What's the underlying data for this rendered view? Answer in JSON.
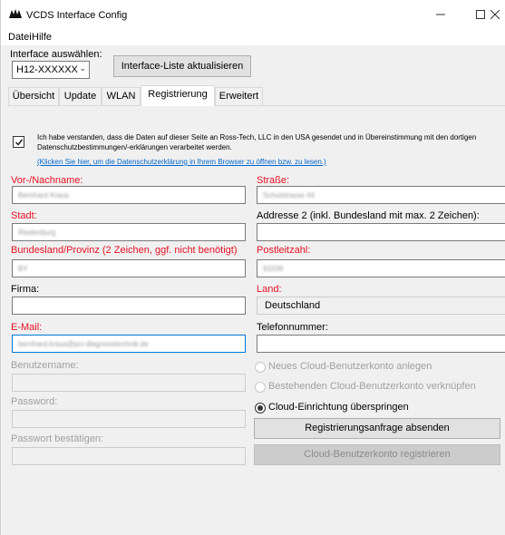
{
  "window": {
    "title": "VCDS Interface Config",
    "controls": {
      "minimize": "—",
      "maximize": "☐",
      "close": "×"
    }
  },
  "menu": {
    "items": [
      "Datei",
      "Hilfe"
    ]
  },
  "interface": {
    "label": "Interface auswählen:",
    "selected": "H12-XXXXXX",
    "refresh_button": "Interface-Liste aktualisieren"
  },
  "tabs": [
    {
      "label": "Übersicht",
      "active": false
    },
    {
      "label": "Update",
      "active": false
    },
    {
      "label": "WLAN",
      "active": false
    },
    {
      "label": "Registrierung",
      "active": true
    },
    {
      "label": "Erweitert",
      "active": false
    }
  ],
  "consent": {
    "checked": true,
    "text": "Ich habe verstanden, dass die Daten auf dieser Seite an Ross-Tech, LLC in den USA gesendet und in Übereinstimmung mit den dortigen Datenschutzbestimmungen/-erklärungen verarbeitet werden.",
    "link": "(Klicken Sie hier, um die Datenschutzerklärung in Ihrem Browser zu öffnen bzw. zu lesen.)"
  },
  "form": {
    "name": {
      "label": "Vor-/Nachname:",
      "value": "Bernhard Kraus"
    },
    "street": {
      "label": "Straße:",
      "value": "Schulstrasse 44"
    },
    "city": {
      "label": "Stadt:",
      "value": "Riedenburg"
    },
    "address2": {
      "label": "Addresse 2 (inkl. Bundesland mit max. 2 Zeichen):",
      "value": ""
    },
    "state": {
      "label": "Bundesland/Provinz (2 Zeichen, ggf. nicht benötigt)",
      "value": "BY"
    },
    "zip": {
      "label": "Postleitzahl:",
      "value": "93339"
    },
    "company": {
      "label": "Firma:",
      "value": ""
    },
    "country": {
      "label": "Land:",
      "value": "Deutschland"
    },
    "email": {
      "label": "E-Mail:",
      "value": "bernhard.kraus@pci-diagnosetechnik.de"
    },
    "phone": {
      "label": "Telefonnummer:",
      "value": ""
    },
    "username": {
      "label": "Benutzername:",
      "value": ""
    },
    "password": {
      "label": "Password:",
      "value": ""
    },
    "password_confirm": {
      "label": "Passwort bestätigen:",
      "value": ""
    }
  },
  "cloud": {
    "options": [
      {
        "label": "Neues Cloud-Benutzerkonto anlegen",
        "selected": false,
        "enabled": false
      },
      {
        "label": "Bestehenden Cloud-Benutzerkonto verknüpfen",
        "selected": false,
        "enabled": false
      },
      {
        "label": "Cloud-Einrichtung überspringen",
        "selected": true,
        "enabled": true
      }
    ],
    "send_button": "Registrierungsanfrage absenden",
    "register_button": "Cloud-Benutzerkonto registrieren"
  }
}
